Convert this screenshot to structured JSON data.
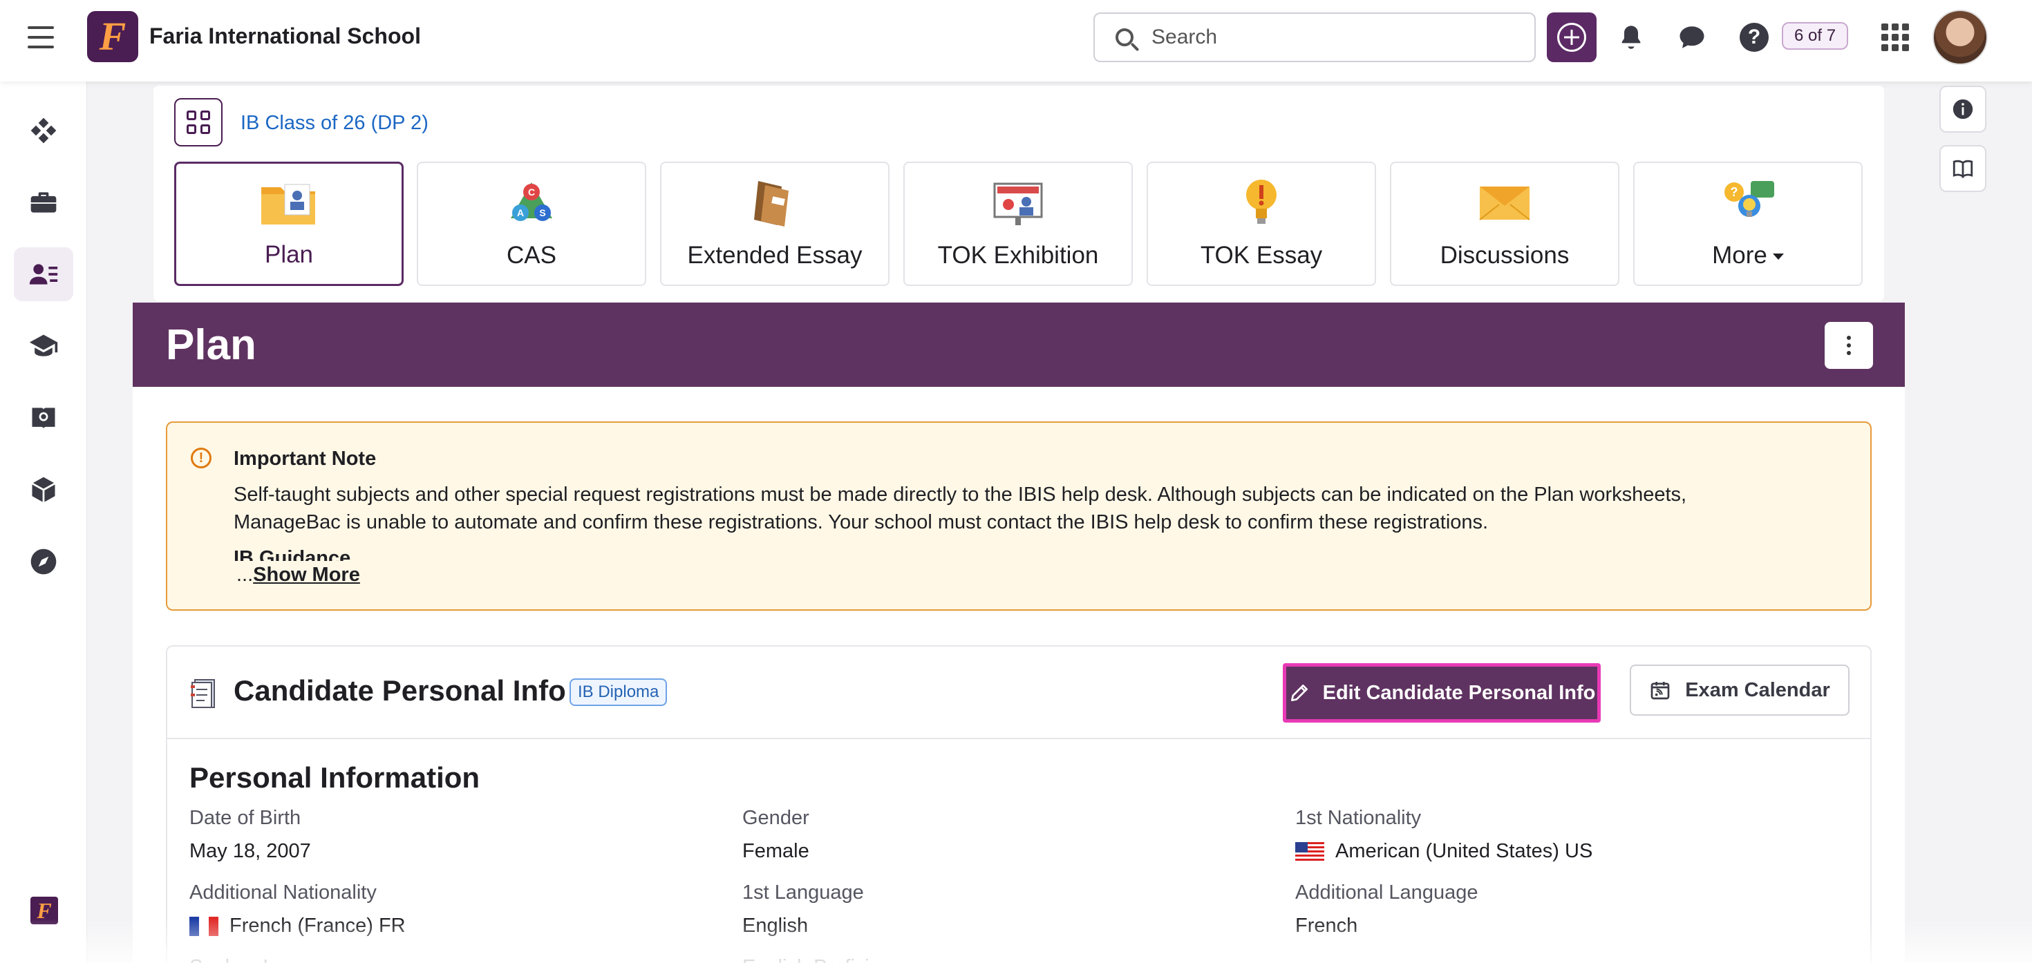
{
  "header": {
    "school_name": "Faria International School",
    "logo_letter": "F",
    "search_placeholder": "Search",
    "counter": "6 of 7",
    "help_glyph": "?"
  },
  "class": {
    "link": "IB Class of 26 (DP 2)"
  },
  "tiles": [
    {
      "label": "Plan",
      "icon": "plan-folder-icon"
    },
    {
      "label": "CAS",
      "icon": "cas-icon"
    },
    {
      "label": "Extended Essay",
      "icon": "books-icon"
    },
    {
      "label": "TOK Exhibition",
      "icon": "exhibition-icon"
    },
    {
      "label": "TOK Essay",
      "icon": "lightbulb-icon"
    },
    {
      "label": "Discussions",
      "icon": "envelope-icon"
    },
    {
      "label": "More",
      "icon": "chat-bulb-icon"
    }
  ],
  "banner": {
    "title": "Plan"
  },
  "note": {
    "title": "Important Note",
    "body": "Self-taught subjects and other special request registrations must be made directly to the IBIS help desk. Although subjects can be indicated on the Plan worksheets, ManageBac is unable to automate and confirm these registrations. Your school must contact the IBIS help desk to confirm these registrations.",
    "guidance": "IB Guidance",
    "ellipsis": "...",
    "show_more": "Show More"
  },
  "candidate": {
    "title": "Candidate Personal Info",
    "badge": "IB Diploma",
    "edit_button": "Edit Candidate Personal Info",
    "calendar_button": "Exam Calendar"
  },
  "personal": {
    "section_title": "Personal Information",
    "fields": [
      {
        "label": "Date of Birth",
        "value": "May 18, 2007"
      },
      {
        "label": "Gender",
        "value": "Female"
      },
      {
        "label": "1st Nationality",
        "value": "American (United States) US"
      },
      {
        "label": "Additional Nationality",
        "value": "French (France) FR"
      },
      {
        "label": "1st Language",
        "value": "English"
      },
      {
        "label": "Additional Language",
        "value": "French"
      },
      {
        "label": "Spoken Language",
        "value": ""
      },
      {
        "label": "English Proficiency",
        "value": ""
      }
    ]
  },
  "colors": {
    "brand_purple": "#5f3361",
    "highlight_pink": "#e83ab5",
    "note_border": "#e69a3a",
    "link_blue": "#1b67c4"
  }
}
